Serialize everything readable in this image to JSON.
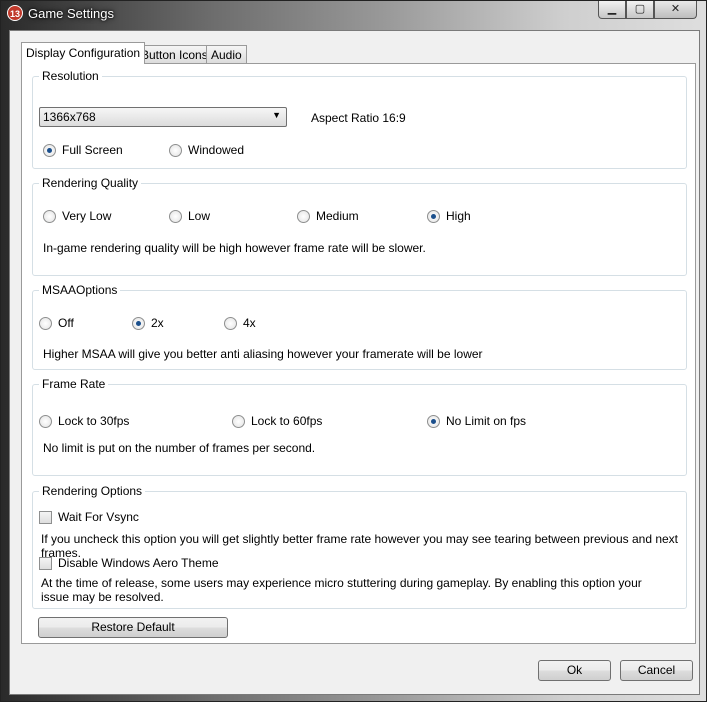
{
  "window": {
    "title": "Game Settings",
    "app_icon_text": "13",
    "controls": {
      "minimize": "▁",
      "maximize": "▢",
      "close": "✕"
    }
  },
  "tabs": [
    {
      "label": "Display Configuration",
      "active": true
    },
    {
      "label": "Button Icons",
      "active": false
    },
    {
      "label": "Audio",
      "active": false
    }
  ],
  "resolution": {
    "group_label": "Resolution",
    "selected": "1366x768",
    "aspect_ratio": "Aspect Ratio 16:9",
    "modes": [
      {
        "label": "Full Screen",
        "selected": true
      },
      {
        "label": "Windowed",
        "selected": false
      }
    ]
  },
  "rendering_quality": {
    "group_label": "Rendering Quality",
    "options": [
      {
        "label": "Very Low",
        "selected": false
      },
      {
        "label": "Low",
        "selected": false
      },
      {
        "label": "Medium",
        "selected": false
      },
      {
        "label": "High",
        "selected": true
      }
    ],
    "description": "In-game rendering quality will be high however frame rate will be slower."
  },
  "msaa": {
    "group_label": "MSAAOptions",
    "options": [
      {
        "label": "Off",
        "selected": false
      },
      {
        "label": "2x",
        "selected": true
      },
      {
        "label": "4x",
        "selected": false
      }
    ],
    "description": "Higher MSAA will give you better anti aliasing however your framerate will be lower"
  },
  "frame_rate": {
    "group_label": "Frame Rate",
    "options": [
      {
        "label": "Lock  to 30fps",
        "selected": false
      },
      {
        "label": "Lock to 60fps",
        "selected": false
      },
      {
        "label": "No Limit on fps",
        "selected": true
      }
    ],
    "description": "No limit is put on the number of frames per second."
  },
  "rendering_options": {
    "group_label": "Rendering Options",
    "vsync_label": "Wait For Vsync",
    "vsync_checked": false,
    "vsync_description": "If you uncheck this option you will get slightly better frame rate however you may see tearing between previous and next frames.",
    "aero_label": "Disable Windows Aero Theme",
    "aero_checked": false,
    "aero_description": "At the time of release, some users may experience micro stuttering during gameplay. By enabling this option your issue may be resolved."
  },
  "buttons": {
    "restore_default": "Restore Default",
    "ok": "Ok",
    "cancel": "Cancel"
  }
}
